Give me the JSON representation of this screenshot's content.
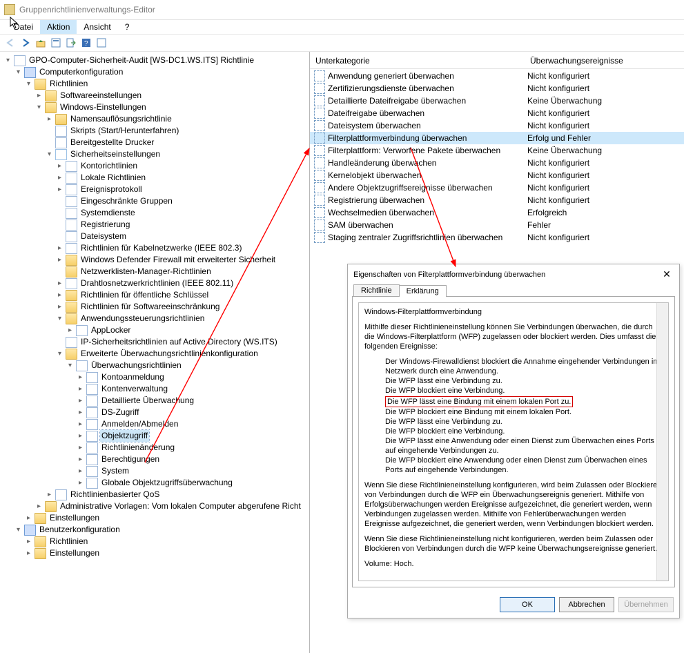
{
  "window_title": "Gruppenrichtlinienverwaltungs-Editor",
  "menu": {
    "datei": "Datei",
    "aktion": "Aktion",
    "ansicht": "Ansicht",
    "help": "?"
  },
  "tree": {
    "root": "GPO-Computer-Sicherheit-Audit [WS-DC1.WS.ITS] Richtlinie",
    "computer": "Computerkonfiguration",
    "richtlinien": "Richtlinien",
    "software": "Softwareeinstellungen",
    "windows": "Windows-Einstellungen",
    "namens": "Namensauflösungsrichtlinie",
    "skripts": "Skripts (Start/Herunterfahren)",
    "drucker": "Bereitgestellte Drucker",
    "sicherheit": "Sicherheitseinstellungen",
    "konto": "Kontorichtlinien",
    "lokal": "Lokale Richtlinien",
    "ereignis": "Ereignisprotokoll",
    "gruppen": "Eingeschränkte Gruppen",
    "dienste": "Systemdienste",
    "registrierung": "Registrierung",
    "dateisystem": "Dateisystem",
    "kabel": "Richtlinien für Kabelnetzwerke (IEEE 802.3)",
    "firewall": "Windows Defender Firewall mit erweiterter Sicherheit",
    "netlisten": "Netzwerklisten-Manager-Richtlinien",
    "wlan": "Drahtlosnetzwerkrichtlinien (IEEE 802.11)",
    "pubkey": "Richtlinien für öffentliche Schlüssel",
    "softrestrict": "Richtlinien für Softwareeinschränkung",
    "appctrl": "Anwendungssteuerungsrichtlinien",
    "applocker": "AppLocker",
    "ipsec": "IP-Sicherheitsrichtlinien auf Active Directory (WS.ITS)",
    "erwaudit": "Erweiterte Überwachungsrichtlinienkonfiguration",
    "auditpol": "Überwachungsrichtlinien",
    "kontoanm": "Kontoanmeldung",
    "kontoverw": "Kontenverwaltung",
    "detail": "Detaillierte Überwachung",
    "dszugriff": "DS-Zugriff",
    "anmelden": "Anmelden/Abmelden",
    "objekt": "Objektzugriff",
    "richtaend": "Richtlinienänderung",
    "berecht": "Berechtigungen",
    "system": "System",
    "globalobj": "Globale Objektzugriffsüberwachung",
    "qos": "Richtlinienbasierter QoS",
    "adminvorl": "Administrative Vorlagen: Vom lokalen Computer abgerufene Richt",
    "einstellungen": "Einstellungen",
    "benutzer": "Benutzerkonfiguration",
    "brichtlinien": "Richtlinien",
    "beinstell": "Einstellungen"
  },
  "list": {
    "headers": {
      "c1": "Unterkategorie",
      "c2": "Überwachungsereignisse"
    },
    "rows": [
      {
        "label": "Anwendung generiert überwachen",
        "state": "Nicht konfiguriert"
      },
      {
        "label": "Zertifizierungsdienste überwachen",
        "state": "Nicht konfiguriert"
      },
      {
        "label": "Detaillierte Dateifreigabe überwachen",
        "state": "Keine Überwachung"
      },
      {
        "label": "Dateifreigabe überwachen",
        "state": "Nicht konfiguriert"
      },
      {
        "label": "Dateisystem überwachen",
        "state": "Nicht konfiguriert"
      },
      {
        "label": "Filterplattformverbindung überwachen",
        "state": "Erfolg und Fehler",
        "selected": true
      },
      {
        "label": "Filterplattform: Verworfene Pakete überwachen",
        "state": "Keine Überwachung"
      },
      {
        "label": "Handleänderung überwachen",
        "state": "Nicht konfiguriert"
      },
      {
        "label": "Kernelobjekt überwachen",
        "state": "Nicht konfiguriert"
      },
      {
        "label": "Andere Objektzugriffsereignisse überwachen",
        "state": "Nicht konfiguriert"
      },
      {
        "label": "Registrierung überwachen",
        "state": "Nicht konfiguriert"
      },
      {
        "label": "Wechselmedien überwachen",
        "state": "Erfolgreich"
      },
      {
        "label": "SAM überwachen",
        "state": "Fehler"
      },
      {
        "label": "Staging zentraler Zugriffsrichtlinien überwachen",
        "state": "Nicht konfiguriert"
      }
    ]
  },
  "dialog": {
    "title": "Eigenschaften von Filterplattformverbindung überwachen",
    "tabs": {
      "policy": "Richtlinie",
      "explain": "Erklärung"
    },
    "heading": "Windows-Filterplattformverbindung",
    "p1": "Mithilfe dieser Richtlinieneinstellung können Sie Verbindungen überwachen, die durch die Windows-Filterplattform (WFP) zugelassen oder blockiert werden. Dies umfasst die folgenden Ereignisse:",
    "b1": "Der Windows-Firewalldienst blockiert die Annahme eingehender Verbindungen im Netzwerk durch eine Anwendung.",
    "b2": "Die WFP lässt eine Verbindung zu.",
    "b3": "Die WFP blockiert eine Verbindung.",
    "b4": "Die WFP lässt eine Bindung mit einem lokalen Port zu.",
    "b5": "Die WFP blockiert eine Bindung mit einem lokalen Port.",
    "b6": "Die WFP lässt eine Verbindung zu.",
    "b7": "Die WFP blockiert eine Verbindung.",
    "b8": "Die WFP lässt eine Anwendung oder einen Dienst zum Überwachen eines Ports auf eingehende Verbindungen zu.",
    "b9": "Die WFP blockiert eine Anwendung oder einen Dienst zum Überwachen eines Ports auf eingehende Verbindungen.",
    "p2": "Wenn Sie diese Richtlinieneinstellung konfigurieren, wird beim Zulassen oder Blockieren von Verbindungen durch die WFP ein Überwachungsereignis generiert. Mithilfe von Erfolgsüberwachungen werden Ereignisse aufgezeichnet, die generiert werden, wenn Verbindungen zugelassen werden. Mithilfe von Fehlerüberwachungen werden Ereignisse aufgezeichnet, die generiert werden, wenn Verbindungen blockiert werden.",
    "p3": "Wenn Sie diese Richtlinieneinstellung nicht konfigurieren, werden beim Zulassen oder Blockieren von Verbindungen durch die WFP keine Überwachungsereignisse generiert.",
    "volume": "Volume: Hoch.",
    "ok": "OK",
    "cancel": "Abbrechen",
    "apply": "Übernehmen"
  }
}
